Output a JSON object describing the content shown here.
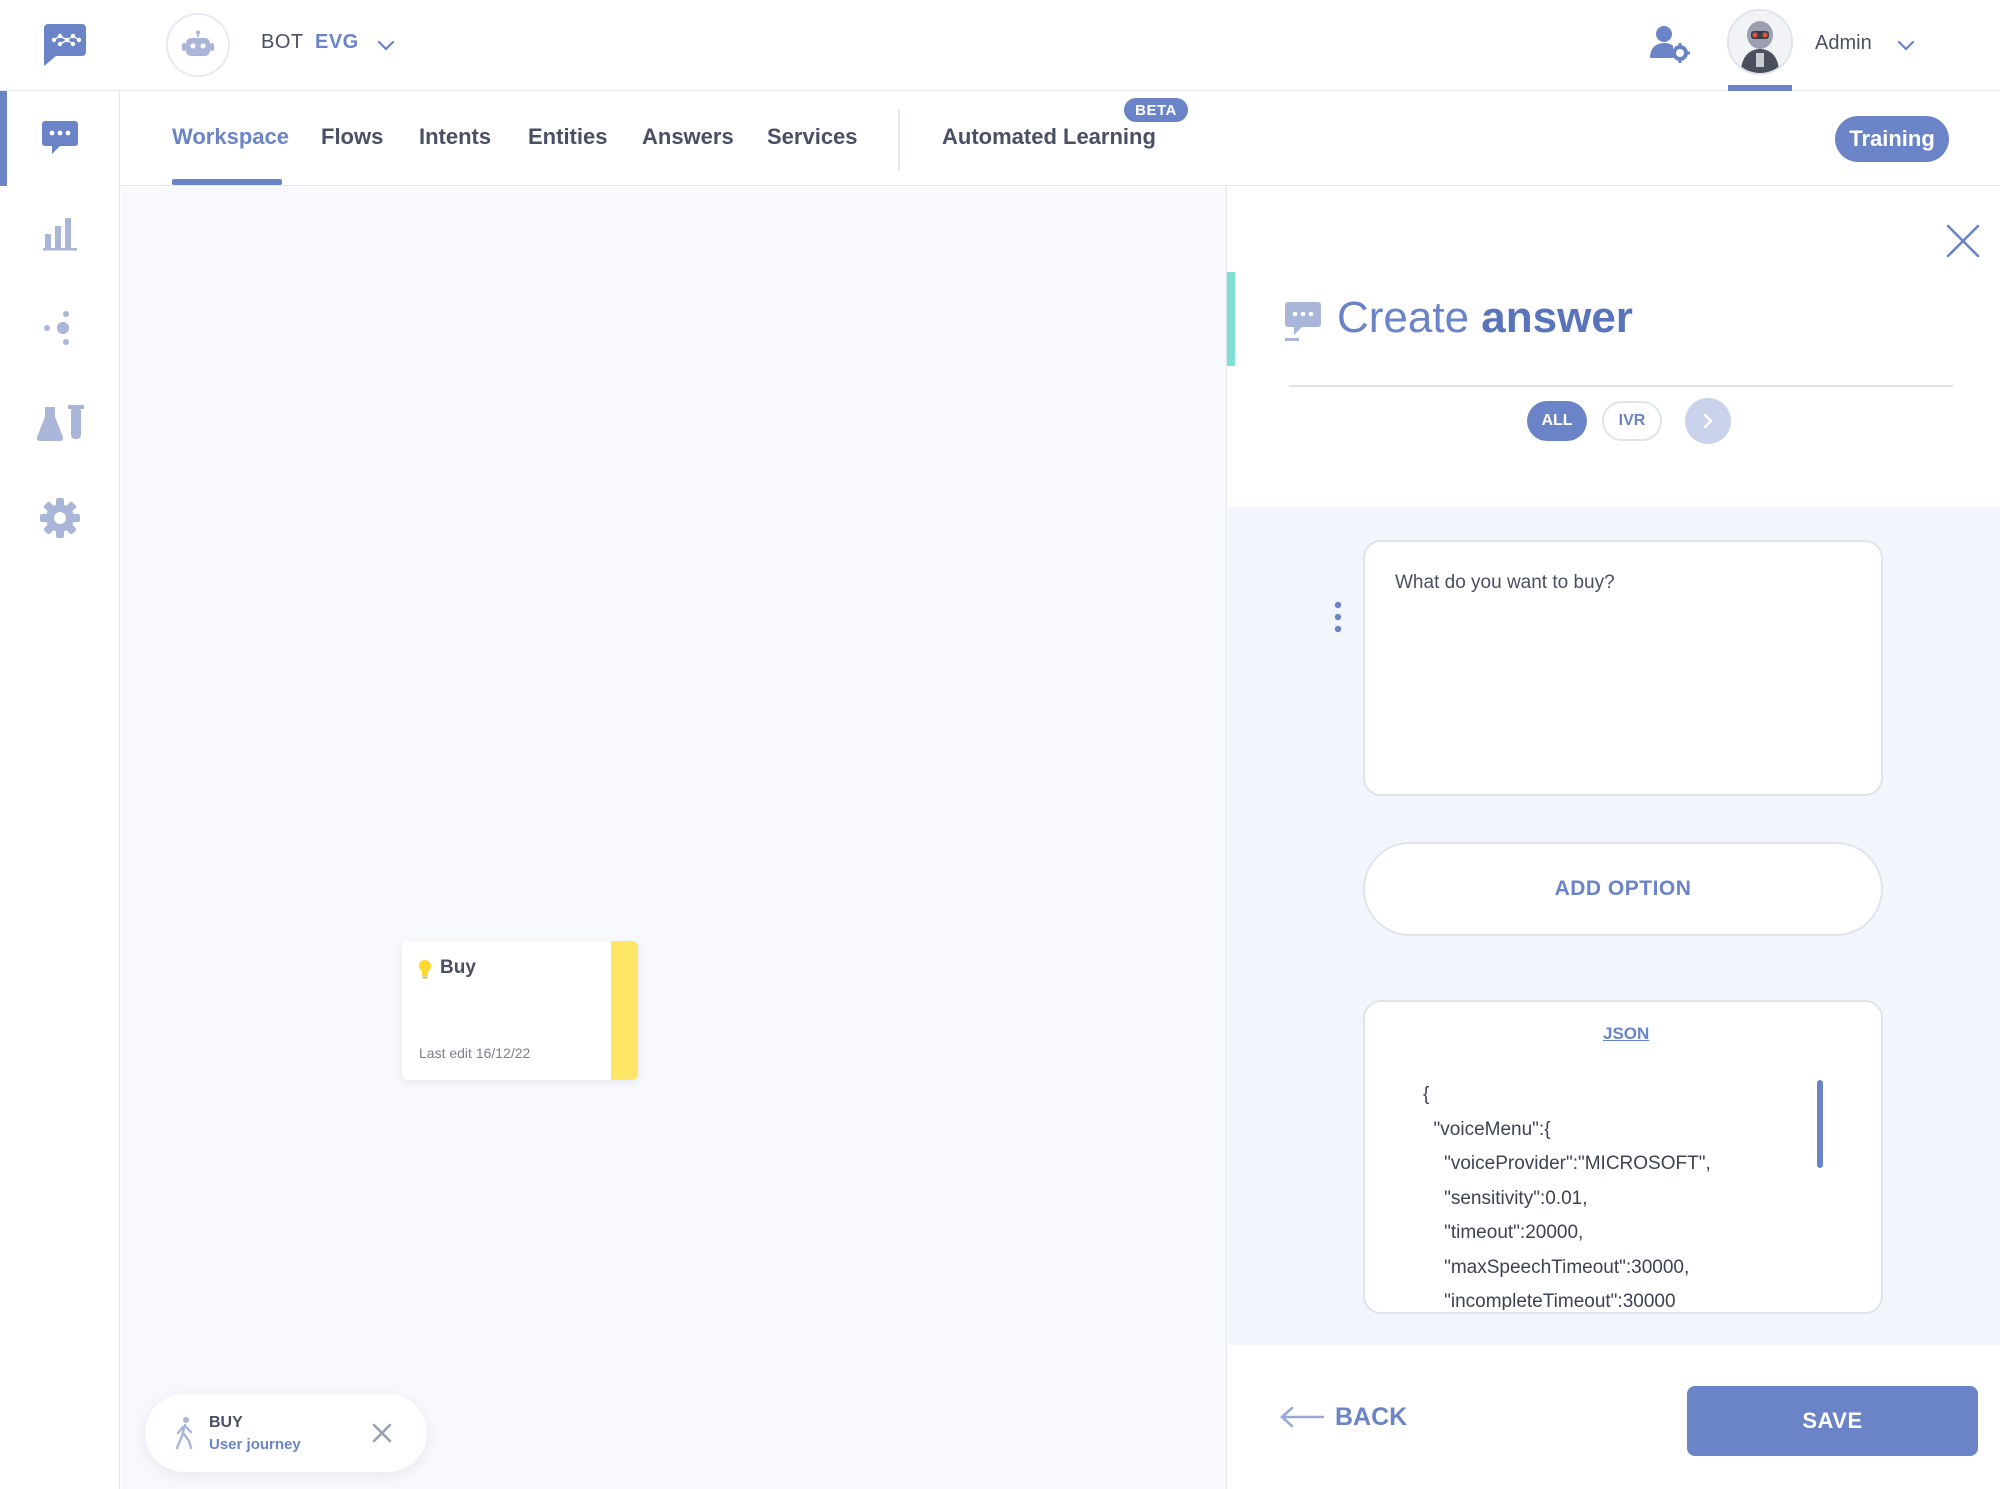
{
  "header": {
    "bot_prefix": "BOT",
    "bot_name": "EVG",
    "user_name": "Admin"
  },
  "nav": {
    "tabs": [
      {
        "label": "Workspace",
        "active": true
      },
      {
        "label": "Flows"
      },
      {
        "label": "Intents"
      },
      {
        "label": "Entities"
      },
      {
        "label": "Answers"
      },
      {
        "label": "Services"
      },
      {
        "label": "Automated Learning"
      }
    ],
    "beta_badge": "BETA",
    "training_label": "Training"
  },
  "rail": {
    "items": [
      "chat-icon",
      "bar-chart-icon",
      "nodes-icon",
      "lab-icon",
      "gear-icon"
    ]
  },
  "canvas": {
    "node": {
      "title": "Buy",
      "last_edit": "Last edit 16/12/22",
      "accent_color": "#ffe566"
    },
    "journey": {
      "title": "BUY",
      "subtitle": "User journey"
    }
  },
  "panel": {
    "title_light": "Create ",
    "title_bold": "answer",
    "chips": {
      "all": "ALL",
      "ivr": "IVR"
    },
    "answer_text": "What do you want to buy?",
    "add_option_label": "ADD OPTION",
    "json_label": "JSON",
    "json_code": "{\n  \"voiceMenu\":{\n    \"voiceProvider\":\"MICROSOFT\",\n    \"sensitivity\":0.01,\n    \"timeout\":20000,\n    \"maxSpeechTimeout\":30000,\n    \"incompleteTimeout\":30000",
    "back_label": "BACK",
    "save_label": "SAVE"
  },
  "colors": {
    "accent": "#6b84c7",
    "teal_accent": "#7fe1d3",
    "node_yellow": "#ffe566"
  }
}
